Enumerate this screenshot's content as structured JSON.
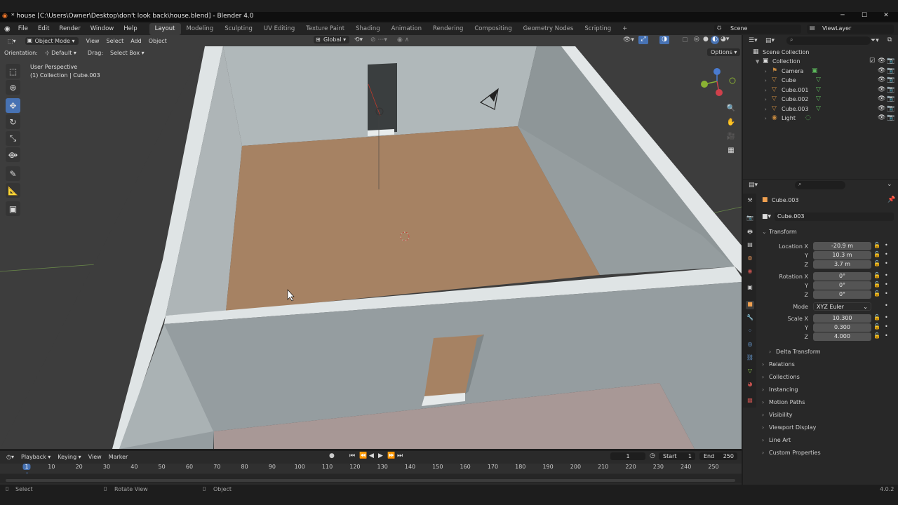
{
  "window": {
    "title": "* house [C:\\Users\\Owner\\Desktop\\don't look back\\house.blend] - Blender 4.0",
    "minimize": "─",
    "maximize": "☐",
    "close": "✕"
  },
  "menu": {
    "items": [
      "File",
      "Edit",
      "Render",
      "Window",
      "Help"
    ],
    "workspaces": [
      "Layout",
      "Modeling",
      "Sculpting",
      "UV Editing",
      "Texture Paint",
      "Shading",
      "Animation",
      "Rendering",
      "Compositing",
      "Geometry Nodes",
      "Scripting"
    ],
    "active_workspace": "Layout",
    "add_tab": "+",
    "scene_label": "Scene",
    "viewlayer_label": "ViewLayer"
  },
  "viewport_header": {
    "mode": "Object Mode",
    "menus": [
      "View",
      "Select",
      "Add",
      "Object"
    ],
    "transform_space": "Global",
    "orientation_label": "Orientation:",
    "orientation_value": "Default",
    "drag_label": "Drag:",
    "drag_value": "Select Box",
    "options": "Options"
  },
  "viewport_overlay": {
    "perspective": "User Perspective",
    "collection_info": "(1) Collection | Cube.003"
  },
  "outliner": {
    "scene_collection": "Scene Collection",
    "collection": "Collection",
    "items": [
      {
        "name": "Camera",
        "icon": "camera-icon"
      },
      {
        "name": "Cube",
        "icon": "mesh-icon"
      },
      {
        "name": "Cube.001",
        "icon": "mesh-icon"
      },
      {
        "name": "Cube.002",
        "icon": "mesh-icon"
      },
      {
        "name": "Cube.003",
        "icon": "mesh-icon"
      },
      {
        "name": "Light",
        "icon": "light-icon"
      }
    ]
  },
  "properties": {
    "object_name": "Cube.003",
    "object_field": "Cube.003",
    "transform_header": "Transform",
    "location_label": "Location X",
    "location": [
      "-20.9 m",
      "10.3 m",
      "3.7 m"
    ],
    "rotation_label": "Rotation X",
    "rotation": [
      "0°",
      "0°",
      "0°"
    ],
    "mode_label": "Mode",
    "mode_value": "XYZ Euler",
    "scale_label": "Scale X",
    "scale": [
      "10.300",
      "0.300",
      "4.000"
    ],
    "axis_y": "Y",
    "axis_z": "Z",
    "delta_transform": "Delta Transform",
    "panels": [
      "Relations",
      "Collections",
      "Instancing",
      "Motion Paths",
      "Visibility",
      "Viewport Display",
      "Line Art",
      "Custom Properties"
    ]
  },
  "timeline": {
    "menus": [
      "Playback",
      "Keying",
      "View",
      "Marker"
    ],
    "current_frame": "1",
    "start_label": "Start",
    "start": "1",
    "end_label": "End",
    "end": "250",
    "ruler": [
      "1",
      "10",
      "20",
      "30",
      "40",
      "50",
      "60",
      "70",
      "80",
      "90",
      "100",
      "110",
      "120",
      "130",
      "140",
      "150",
      "160",
      "170",
      "180",
      "190",
      "200",
      "210",
      "220",
      "230",
      "240",
      "250"
    ]
  },
  "statusbar": {
    "select": "Select",
    "rotate": "Rotate View",
    "object": "Object",
    "version": "4.0.2"
  },
  "colors": {
    "accent": "#4772b3",
    "floor": "#a68263",
    "wall": "#9aa3a5",
    "wall_top": "#dfe4e5",
    "viewport_bg": "#3d3d3d"
  }
}
